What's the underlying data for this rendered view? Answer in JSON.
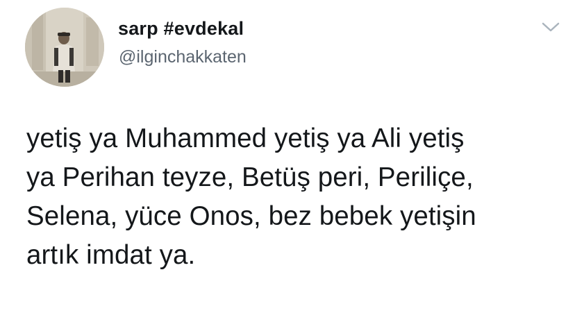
{
  "author": {
    "display_name": "sarp #evdekal",
    "handle": "@ilginchakkaten",
    "avatar_icon": "profile-photo-icon"
  },
  "menu": {
    "icon": "chevron-down-icon"
  },
  "tweet": {
    "lines": [
      "yetiş ya Muhammed yetiş ya Ali yetiş",
      "ya Perihan teyze, Betüş peri, Periliçe,",
      "Selena, yüce Onos, bez bebek yetişin",
      "artık imdat ya."
    ]
  },
  "colors": {
    "text": "#14171a",
    "secondary_text": "#5b6570",
    "background": "#ffffff",
    "caret": "#aab4bd"
  }
}
